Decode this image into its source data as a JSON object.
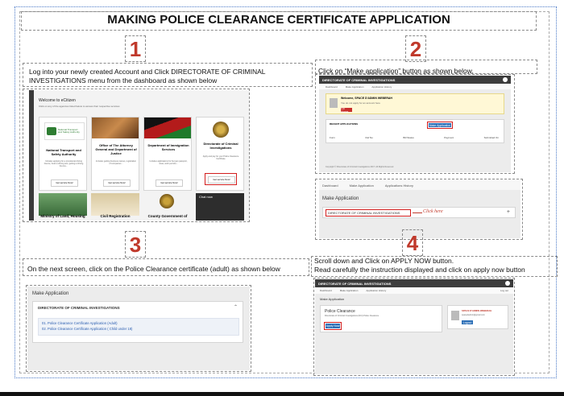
{
  "title": "MAKING POLICE CLEARANCE CERTIFICATE APPLICATION",
  "steps": [
    {
      "number": "1",
      "text": "Log into your newly created Account and Click DIRECTORATE OF CRIMINAL INVESTIGATIONS menu from the dashboard as shown below"
    },
    {
      "number": "2",
      "text": "Click on “Make application” button as shown below."
    },
    {
      "number": "3",
      "text": "On the next screen, click on the Police Clearance certificate (adult) as shown below"
    },
    {
      "number": "4",
      "text": "Scroll down and Click on APPLY NOW button.\nRead carefully the instruction displayed and click on apply now button"
    }
  ],
  "shot1": {
    "welcome": "Welcome to eCitizen",
    "welcome_sub": "Click on any of the agencies listed below to access their respective services",
    "cards": [
      {
        "title": "National Transport and Safety Authority",
        "desc": "Includes applying for a provisional driving licence, book a driving test, getting a driving licence...",
        "button": "Get service Now!"
      },
      {
        "title": "Office of The Attorney General and Department of Justice",
        "desc": "Includes getting business names, registration of companies...",
        "button": "Get service Now!"
      },
      {
        "title": "Department of Immigration Services",
        "desc": "Includes applications for Kenyan passport, visas, work permits...",
        "button": "Get service Now!"
      },
      {
        "title": "Directorate of Criminal Investigations",
        "desc": "Apply and pay for your Police Clearance Certificate",
        "button": "Get service Now!"
      }
    ],
    "row2": [
      "Ministry of Land, Housing",
      "Civil Registration",
      "County Government of"
    ],
    "chat": "Chat now",
    "ntsa_logo": "National Transport and Safety Authority"
  },
  "shot2": {
    "header": "DIRECTORATE OF CRIMINAL INVESTIGATIONS",
    "nav": [
      "Dashboard",
      "Make Application",
      "Application History"
    ],
    "welcome": "Welcome, SPACE D'ADMIN WEBERAH",
    "welcome_line": "You do not apply for an account here",
    "button": "Go Home",
    "table_title": "RECENT APPLICATIONS",
    "make_btn": "Make Application",
    "cols": [
      "Form",
      "Ref No",
      "Bill Status",
      "Payment",
      "Submitted On"
    ],
    "footer": "Copyright © Directorate of Criminal Investigations 2017. All Rights Reserved"
  },
  "shot2b": {
    "nav": [
      "Dashboard",
      "Make Application",
      "Applications History"
    ],
    "section": "Make Application",
    "item": "DIRECTORATE OF CRIMINAL INVESTIGATIONS",
    "click_here": "Click here",
    "plus": "+"
  },
  "shot3": {
    "section": "Make Application",
    "group": "DIRECTORATE OF CRIMINAL INVESTIGATIONS",
    "links": [
      "01. Police Clearance Certificate Application (Adult)",
      "02. Police Clearance Certificate Application ( Child under 18)"
    ],
    "caret": "⌃"
  },
  "shot4": {
    "header": "DIRECTORATE OF CRIMINAL INVESTIGATIONS",
    "nav": [
      "Dashboard",
      "Make Application",
      "Application History"
    ],
    "section": "Make Application",
    "pcc_title": "Police Clearance",
    "pcc_sub": "Directorate of Criminal Investigations (DCI) Police Clearance",
    "apply": "Apply Now",
    "user": "SPACE D'ADMIN WEBERAH",
    "user_line": "spacedadmin@gmail.com",
    "logout": "Logout",
    "logout_top": "Log out"
  }
}
